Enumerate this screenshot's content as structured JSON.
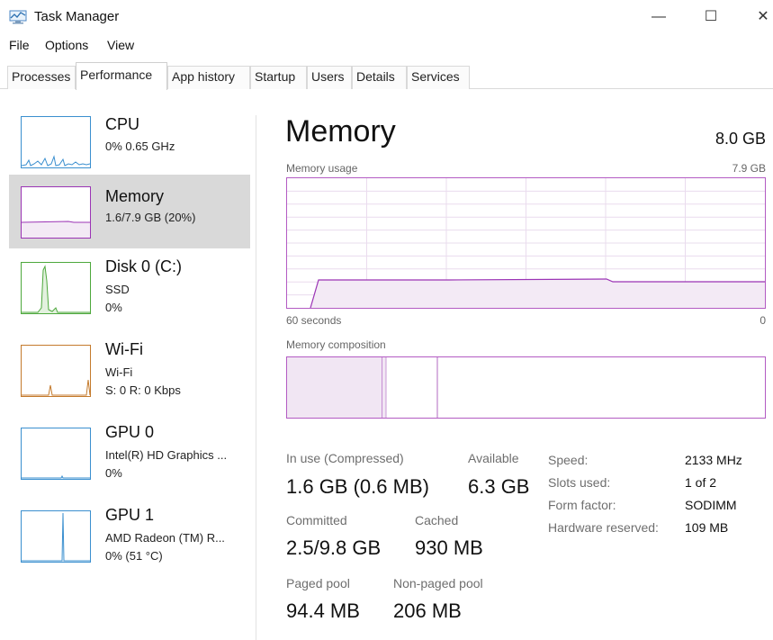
{
  "window": {
    "title": "Task Manager",
    "min_glyph": "—",
    "max_glyph": "☐",
    "close_glyph": "✕",
    "icon": "task-manager-icon"
  },
  "menu": {
    "items": [
      "File",
      "Options",
      "View"
    ]
  },
  "tabs": {
    "items": [
      "Processes",
      "Performance",
      "App history",
      "Startup",
      "Users",
      "Details",
      "Services"
    ],
    "active": "Performance"
  },
  "sidebar": {
    "items": [
      {
        "name": "CPU",
        "line1": "0% 0.65 GHz",
        "line2": "",
        "color": "#3a8fcf"
      },
      {
        "name": "Memory",
        "line1": "1.6/7.9 GB (20%)",
        "line2": "",
        "color": "#9b34b5",
        "selected": true
      },
      {
        "name": "Disk 0 (C:)",
        "line1": "SSD",
        "line2": "0%",
        "color": "#4da83c"
      },
      {
        "name": "Wi-Fi",
        "line1": "Wi-Fi",
        "line2": "S: 0 R: 0 Kbps",
        "color": "#c47a2c"
      },
      {
        "name": "GPU 0",
        "line1": "Intel(R) HD Graphics ...",
        "line2": "0%",
        "color": "#3a8fcf"
      },
      {
        "name": "GPU 1",
        "line1": "AMD Radeon (TM) R...",
        "line2": "0% (51 °C)",
        "color": "#3a8fcf"
      }
    ]
  },
  "main": {
    "title": "Memory",
    "total": "8.0 GB",
    "usage_label": "Memory usage",
    "usage_max": "7.9 GB",
    "time_left": "60 seconds",
    "time_right": "0",
    "composition_label": "Memory composition",
    "usage_fraction": 0.2,
    "stats": {
      "in_use_label": "In use (Compressed)",
      "in_use_value": "1.6 GB (0.6 MB)",
      "available_label": "Available",
      "available_value": "6.3 GB",
      "committed_label": "Committed",
      "committed_value": "2.5/9.8 GB",
      "cached_label": "Cached",
      "cached_value": "930 MB",
      "paged_label": "Paged pool",
      "paged_value": "94.4 MB",
      "nonpaged_label": "Non-paged pool",
      "nonpaged_value": "206 MB"
    },
    "specs": [
      {
        "label": "Speed:",
        "value": "2133 MHz"
      },
      {
        "label": "Slots used:",
        "value": "1 of 2"
      },
      {
        "label": "Form factor:",
        "value": "SODIMM"
      },
      {
        "label": "Hardware reserved:",
        "value": "109 MB"
      }
    ]
  },
  "colors": {
    "memory_accent": "#9b34b5",
    "memory_fill": "#f3eaf5",
    "grid": "#e6d3ea"
  }
}
